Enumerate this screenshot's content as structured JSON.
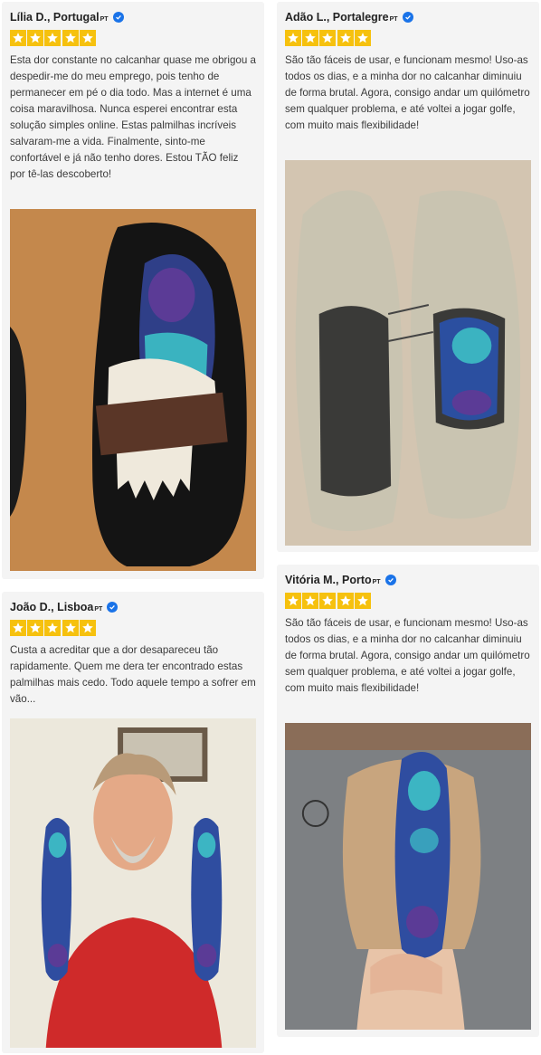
{
  "reviews": [
    {
      "name": "Lília D., Portugal",
      "country": "PT",
      "rating": 5,
      "text": "Esta dor constante no calcanhar quase me obrigou a despedir-me do meu emprego, pois tenho de permanecer em pé o dia todo. Mas a internet é uma coisa maravilhosa. Nunca esperei encontrar esta solução simples online. Estas palmilhas incríveis salvaram-me a vida. Finalmente, sinto-me confortável e já não tenho dores. Estou TÃO feliz por tê-las descoberto!"
    },
    {
      "name": "Adão L., Portalegre",
      "country": "PT",
      "rating": 5,
      "text": "São tão fáceis de usar, e funcionam mesmo! Uso-as todos os dias, e a minha dor no calcanhar diminuiu de forma brutal. Agora, consigo andar um quilómetro sem qualquer problema, e até voltei a jogar golfe, com muito mais flexibilidade!"
    },
    {
      "name": "João D., Lisboa",
      "country": "PT",
      "rating": 5,
      "text": "Custa a acreditar que a dor desapareceu tão rapidamente. Quem me dera ter encontrado estas palmilhas mais cedo. Todo aquele tempo a sofrer em vão..."
    },
    {
      "name": "Vitória M., Porto",
      "country": "PT",
      "rating": 5,
      "text": "São tão fáceis de usar, e funcionam mesmo! Uso-as todos os dias, e a minha dor no calcanhar diminuiu de forma brutal. Agora, consigo andar um quilómetro sem qualquer problema, e até voltei a jogar golfe, com muito mais flexibilidade!"
    }
  ],
  "colors": {
    "star": "#f6c10e",
    "verified": "#1a73e8",
    "card": "#f4f4f4"
  }
}
